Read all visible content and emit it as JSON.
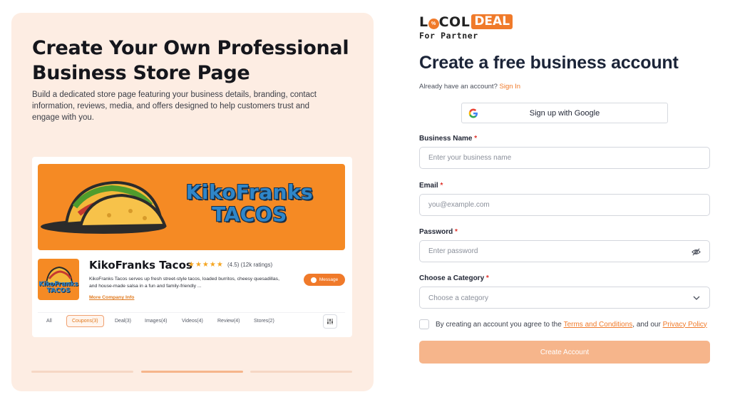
{
  "promo": {
    "title": "Create Your Own Professional Business Store Page",
    "description": "Build a dedicated store page featuring your business details, branding, contact information, reviews, media, and offers designed to help customers trust and engage with you.",
    "store_card": {
      "banner_text": "KikoFranks TACOS",
      "logo_text": "KikoFranks TACOS",
      "name": "KikoFranks Tacos",
      "stars": "★★★★★",
      "rating_text": "(4.5) (12k ratings)",
      "rating_value": 4.5,
      "description": "KikoFranks Tacos serves up fresh street-style tacos, loaded burritos, cheesy quesadillas, and house-made salsa in a fun and family-friendly ...",
      "more_info": "More Company Info",
      "message_label": "Message",
      "tabs": [
        {
          "label": "All"
        },
        {
          "label": "Coupons(3)"
        },
        {
          "label": "Deal(3)"
        },
        {
          "label": "Images(4)"
        },
        {
          "label": "Videos(4)"
        },
        {
          "label": "Review(4)"
        },
        {
          "label": "Stores(2)"
        }
      ]
    },
    "carousel_active_index": 2
  },
  "brand": {
    "logo_part1": "L",
    "logo_pct": "%",
    "logo_part2": "COL",
    "logo_deal": "DEAL",
    "sub": "For Partner"
  },
  "form": {
    "title": "Create a free business account",
    "signin_prompt": "Already have an account?",
    "signin_link": "Sign In",
    "google_label": "Sign up with Google",
    "business_name": {
      "label": "Business Name",
      "required": "*",
      "placeholder": "Enter your business name"
    },
    "email": {
      "label": "Email",
      "required": "*",
      "placeholder": "you@example.com"
    },
    "password": {
      "label": "Password",
      "required": "*",
      "placeholder": "Enter password"
    },
    "category": {
      "label": "Choose a Category",
      "required": "*",
      "placeholder": "Choose a category"
    },
    "agree_prefix": "By creating an account you agree to the",
    "terms_link": "Terms and Conditions",
    "agree_mid": ", and our",
    "privacy_link": "Privacy Policy",
    "submit_label": "Create Account"
  },
  "colors": {
    "accent": "#f07a2a",
    "panel_bg": "#fdede3",
    "button_disabled": "#f6b58b"
  }
}
